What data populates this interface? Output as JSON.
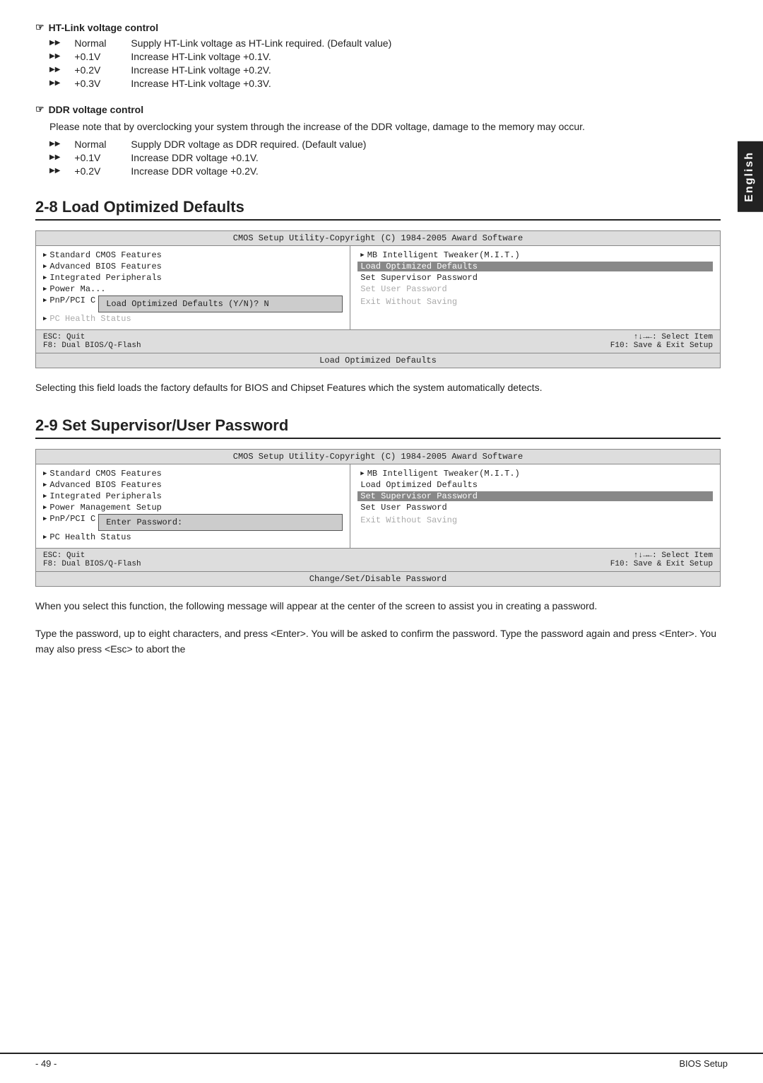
{
  "english_tab": "English",
  "ht_link": {
    "title": "HT-Link voltage control",
    "items": [
      {
        "key": "Normal",
        "desc": "Supply HT-Link voltage as HT-Link required. (Default value)"
      },
      {
        "key": "+0.1V",
        "desc": "Increase HT-Link voltage +0.1V."
      },
      {
        "key": "+0.2V",
        "desc": "Increase HT-Link voltage +0.2V."
      },
      {
        "key": "+0.3V",
        "desc": "Increase HT-Link voltage +0.3V."
      }
    ]
  },
  "ddr_voltage": {
    "title": "DDR voltage control",
    "note": "Please note that by overclocking your system through the increase of the DDR voltage, damage to the memory may occur.",
    "items": [
      {
        "key": "Normal",
        "desc": "Supply DDR voltage as DDR required. (Default value)"
      },
      {
        "key": "+0.1V",
        "desc": "Increase DDR voltage +0.1V."
      },
      {
        "key": "+0.2V",
        "desc": "Increase DDR voltage +0.2V."
      }
    ]
  },
  "section28": {
    "number": "2-8",
    "title": "Load Optimized Defaults",
    "bios_title": "CMOS Setup Utility-Copyright (C) 1984-2005 Award Software",
    "left_items": [
      "Standard CMOS Features",
      "Advanced BIOS Features",
      "Integrated Peripherals",
      "Power Ma...",
      "PnP/PCI C",
      "PC Health Status"
    ],
    "right_header": "MB Intelligent Tweaker(M.I.T.)",
    "right_items": [
      {
        "label": "Load Optimized Defaults",
        "selected": true
      },
      {
        "label": "Set Supervisor Password",
        "selected": false
      },
      {
        "label": "Set User Password",
        "selected": false,
        "strikethrough": true
      }
    ],
    "dialog": "Load Optimized Defaults (Y/N)? N",
    "right_items2": [
      {
        "label": "Exit Without Saving",
        "strikethrough": false
      }
    ],
    "footer_left1": "ESC: Quit",
    "footer_left2": "F8: Dual BIOS/Q-Flash",
    "footer_right1": "↑↓→←: Select Item",
    "footer_right2": "F10: Save & Exit Setup",
    "status_bar": "Load Optimized Defaults",
    "desc": "Selecting this field loads the factory defaults for BIOS and Chipset Features which the system automatically detects."
  },
  "section29": {
    "number": "2-9",
    "title": "Set Supervisor/User Password",
    "bios_title": "CMOS Setup Utility-Copyright (C) 1984-2005 Award Software",
    "left_items": [
      "Standard CMOS Features",
      "Advanced BIOS Features",
      "Integrated Peripherals",
      "Power Management Setup",
      "PnP/PCI C",
      "PC Health Status"
    ],
    "right_header": "MB Intelligent Tweaker(M.I.T.)",
    "right_items": [
      {
        "label": "Load Optimized Defaults",
        "selected": false
      },
      {
        "label": "Set Supervisor Password",
        "selected": true
      },
      {
        "label": "Set User Password",
        "selected": false
      }
    ],
    "dialog": "Enter Password:",
    "right_items2": [
      {
        "label": "Exit Without Saving",
        "strikethrough": false
      }
    ],
    "footer_left1": "ESC: Quit",
    "footer_left2": "F8: Dual BIOS/Q-Flash",
    "footer_right1": "↑↓→←: Select Item",
    "footer_right2": "F10: Save & Exit Setup",
    "status_bar": "Change/Set/Disable Password",
    "desc1": "When you select this function, the following message will appear at the center of the screen to assist you in creating a password.",
    "desc2": "Type the password, up to eight characters, and press <Enter>. You will be asked to confirm the password. Type the password again and press <Enter>. You may also press <Esc> to abort the"
  },
  "footer": {
    "page": "- 49 -",
    "section": "BIOS Setup"
  }
}
